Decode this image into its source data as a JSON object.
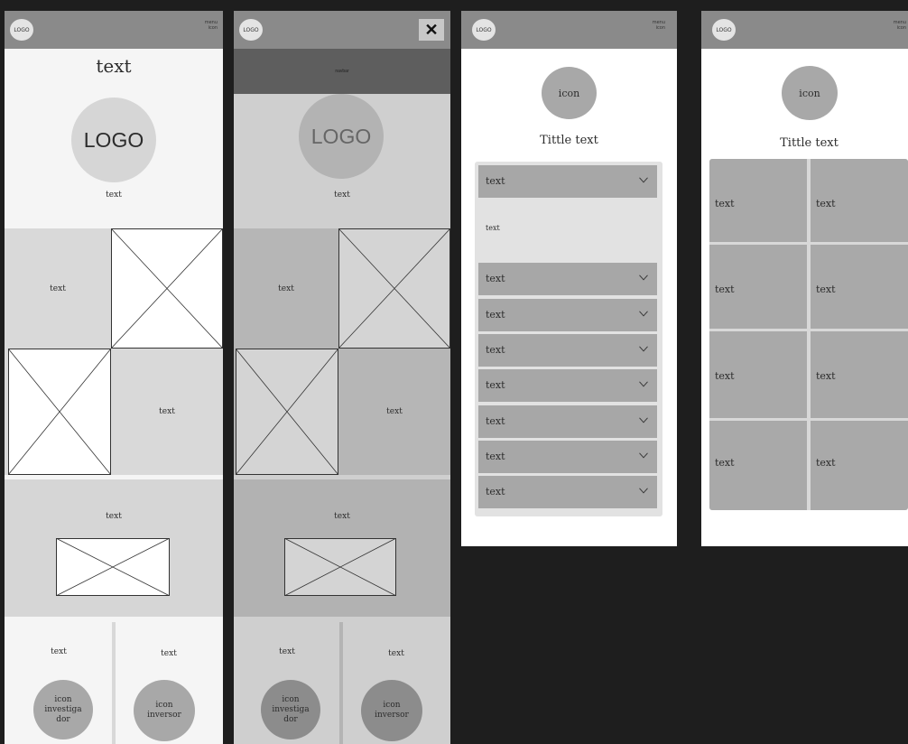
{
  "screen1": {
    "logo_pill": "LOGO",
    "menu_icon": "menu\nicon",
    "hero_title": "text",
    "hero_logo": "LOGO",
    "hero_caption": "text",
    "grid_text_a": "text",
    "grid_text_b": "text",
    "banner_text": "text",
    "col_left_text": "text",
    "col_right_text": "text",
    "icon_investigador": "icon\ninvestiga\ndor",
    "icon_inversor": "icon\ninversor"
  },
  "screen2": {
    "logo_pill": "LOGO",
    "close_icon": "✕",
    "nav_label": "navbar",
    "hero_logo": "LOGO",
    "hero_caption": "text",
    "grid_text_a": "text",
    "grid_text_b": "text",
    "banner_text": "text",
    "col_left_text": "text",
    "col_right_text": "text",
    "icon_investigador": "icon\ninvestiga\ndor",
    "icon_inversor": "icon\ninversor"
  },
  "screen3": {
    "logo_pill": "LOGO",
    "menu_icon": "menu\nicon",
    "icon_label": "icon",
    "title": "Tittle text",
    "accordion_open_label": "text",
    "accordion_open_body": "text",
    "accordion_rows": [
      "text",
      "text",
      "text",
      "text",
      "text",
      "text",
      "text"
    ]
  },
  "screen4": {
    "logo_pill": "LOGO",
    "menu_icon": "menu\nicon",
    "icon_label": "icon",
    "title": "Tittle text",
    "cells": [
      [
        "text",
        "text"
      ],
      [
        "text",
        "text"
      ],
      [
        "text",
        "text"
      ],
      [
        "text",
        "text"
      ]
    ]
  },
  "colors": {
    "canvas": "#1e1e1e",
    "topbar": "#8a8a8a",
    "light_gray": "#d4d4d4",
    "mid_gray": "#a9a9a9",
    "dark_gray": "#5f5f5f"
  }
}
